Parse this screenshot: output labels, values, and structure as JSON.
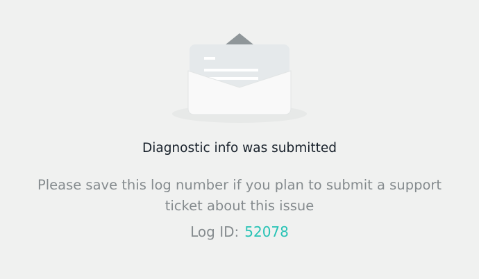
{
  "message": {
    "title": "Diagnostic info was submitted",
    "description": "Please save this log number if you plan to submit a support ticket about this issue",
    "log_label": "Log ID:",
    "log_id": "52078"
  },
  "colors": {
    "background": "#f0f1f0",
    "accent": "#27c3b5",
    "title_text": "#17202a",
    "muted_text": "#858b8e"
  },
  "icons": {
    "illustration": "envelope-open-letter-icon"
  }
}
